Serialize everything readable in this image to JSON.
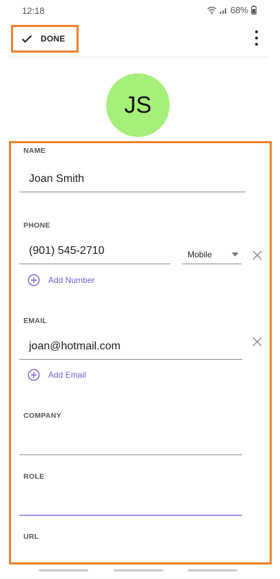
{
  "status_bar": {
    "time": "12:18",
    "battery": "68%",
    "icons": [
      "wifi-icon",
      "signal-icon",
      "battery-icon"
    ]
  },
  "toolbar": {
    "done_label": "DONE",
    "done_icon": "check-icon",
    "more_icon": "more-vert-icon"
  },
  "avatar": {
    "initials": "JS",
    "color": "#a6ef7a"
  },
  "form": {
    "name": {
      "label": "NAME",
      "value": "Joan Smith"
    },
    "phone": {
      "label": "PHONE",
      "value": "(901) 545-2710",
      "type": "Mobile",
      "add_label": "Add Number"
    },
    "email": {
      "label": "EMAIL",
      "value": "joan@hotmail.com",
      "add_label": "Add Email"
    },
    "company": {
      "label": "COMPANY",
      "value": ""
    },
    "role": {
      "label": "ROLE",
      "value": ""
    },
    "url": {
      "label": "URL"
    }
  },
  "colors": {
    "highlight": "#f0802a",
    "accent": "#7b5cd6",
    "active_underline": "#9b9bf0"
  }
}
